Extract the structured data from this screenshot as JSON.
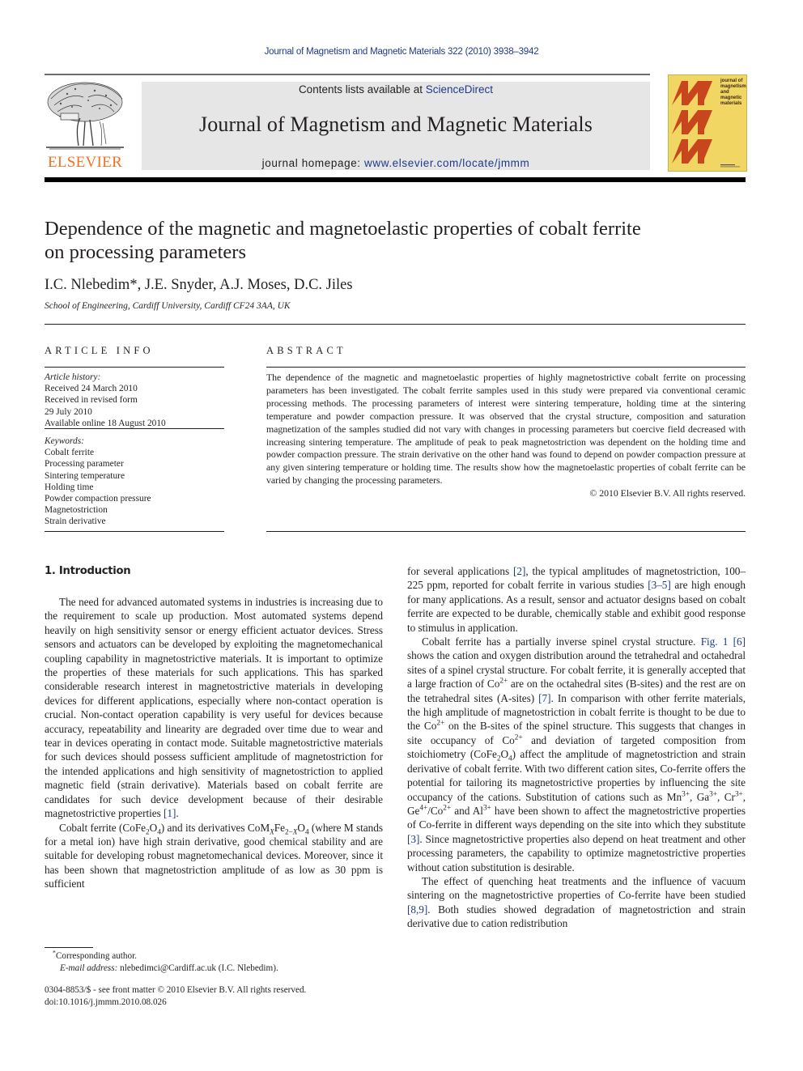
{
  "running_head": "Journal of Magnetism and Magnetic Materials 322 (2010) 3938–3942",
  "header": {
    "publisher_logo_text": "ELSEVIER",
    "contents_prefix": "Contents lists available at ",
    "contents_link": "ScienceDirect",
    "journal_title": "Journal of Magnetism and Magnetic Materials",
    "homepage_prefix": "journal homepage: ",
    "homepage_link": "www.elsevier.com/locate/jmmm",
    "cover_text": "journal of magnetism and magnetic materials",
    "cover_logo": "MMM",
    "colors": {
      "elsevier_orange": "#f37021",
      "cover_yellow": "#f2d663",
      "cover_red": "#c8461e",
      "link_blue": "#1f3a8a",
      "banner_gray": "#e6e6e6"
    }
  },
  "article": {
    "title": "Dependence of the magnetic and magnetoelastic properties of cobalt ferrite on processing parameters",
    "authors": "I.C. Nlebedim*, J.E. Snyder, A.J. Moses, D.C. Jiles",
    "affiliation": "School of Engineering, Cardiff University, Cardiff CF24 3AA, UK"
  },
  "article_info": {
    "label": "ARTICLE INFO",
    "history_label": "Article history:",
    "history": [
      "Received 24 March 2010",
      "Received in revised form",
      "29 July 2010",
      "Available online 18 August 2010"
    ],
    "keywords_label": "Keywords:",
    "keywords": [
      "Cobalt ferrite",
      "Processing parameter",
      "Sintering temperature",
      "Holding time",
      "Powder compaction pressure",
      "Magnetostriction",
      "Strain derivative"
    ]
  },
  "abstract": {
    "label": "ABSTRACT",
    "text": "The dependence of the magnetic and magnetoelastic properties of highly magnetostrictive cobalt ferrite on processing parameters has been investigated. The cobalt ferrite samples used in this study were prepared via conventional ceramic processing methods. The processing parameters of interest were sintering temperature, holding time at the sintering temperature and powder compaction pressure. It was observed that the crystal structure, composition and saturation magnetization of the samples studied did not vary with changes in processing parameters but coercive field decreased with increasing sintering temperature. The amplitude of peak to peak magnetostriction was dependent on the holding time and powder compaction pressure. The strain derivative on the other hand was found to depend on powder compaction pressure at any given sintering temperature or holding time. The results show how the magnetoelastic properties of cobalt ferrite can be varied by changing the processing parameters.",
    "copyright": "© 2010 Elsevier B.V. All rights reserved."
  },
  "intro": {
    "heading": "1.  Introduction",
    "p1": "The need for advanced automated systems in industries is increasing due to the requirement to scale up production. Most automated systems depend heavily on high sensitivity sensor or energy efficient actuator devices. Stress sensors and actuators can be developed by exploiting the magnetomechanical coupling capability in magnetostrictive materials. It is important to optimize the properties of these materials for such applications. This has sparked considerable research interest in magnetostrictive materials in developing devices for different applications, especially where non-contact operation is crucial. Non-contact operation capability is very useful for devices because accuracy, repeatability and linearity are degraded over time due to wear and tear in devices operating in contact mode. Suitable magnetostrictive materials for such devices should possess sufficient amplitude of magnetostriction for the intended applications and high sensitivity of magnetostriction to applied magnetic field (strain derivative). Materials based on cobalt ferrite are candidates for such device development because of their desirable magnetostrictive properties ",
    "ref1": "[1]",
    "p2_a": "Cobalt ferrite (CoFe",
    "p2_b": ") and its derivatives CoM",
    "p2_c": " (where M stands for a metal ion) have high strain derivative, good chemical stability and are suitable for developing robust magnetomechanical devices. Moreover, since it has been shown that magnetostriction amplitude of as low as 30 ppm is sufficient",
    "r_p1_a": "for several applications ",
    "ref2": "[2]",
    "r_p1_b": ", the typical amplitudes of magnetostriction, 100–225 ppm, reported for cobalt ferrite in various studies ",
    "ref3_5": "[3–5]",
    "r_p1_c": " are high enough for many applications. As a result, sensor and actuator designs based on cobalt ferrite are expected to be durable, chemically stable and exhibit good response to stimulus in application.",
    "r_p2_a": "Cobalt ferrite has a partially inverse spinel crystal structure. ",
    "fig1": "Fig. 1",
    "ref6": "[6]",
    "r_p2_b": " shows the cation and oxygen distribution around the tetrahedral and octahedral sites of a spinel crystal structure. For cobalt ferrite, it is generally accepted that a large fraction of Co",
    "r_p2_c": " are on the octahedral sites (B-sites) and the rest are on the tetrahedral sites (A-sites) ",
    "ref7": "[7]",
    "r_p2_d": ". In comparison with other ferrite materials, the high amplitude of magnetostriction in cobalt ferrite is thought to be due to the Co",
    "r_p2_e": " on the B-sites of the spinel structure. This suggests that changes in site occupancy of Co",
    "r_p2_f": " and deviation of targeted composition from stoichiometry (CoFe",
    "r_p2_g": ") affect the amplitude of magnetostriction and strain derivative of cobalt ferrite. With two different cation sites, Co-ferrite offers the potential for tailoring its magnetostrictive properties by influencing the site occupancy of the cations. Substitution of cations such as Mn",
    "r_p2_h": " have been shown to affect the magnetostrictive properties of Co-ferrite in different ways depending on the site into which they substitute ",
    "ref3": "[3]",
    "r_p2_i": ". Since magnetostrictive properties also depend on heat treatment and other processing parameters, the capability to optimize magnetostrictive properties without cation substitution is desirable.",
    "r_p3_a": "The effect of quenching heat treatments and the influence of vacuum sintering on the magnetostrictive properties of Co-ferrite have been studied ",
    "ref8_9": "[8,9]",
    "r_p3_b": ". Both studies showed degradation of magnetostriction and strain derivative due to cation redistribution"
  },
  "footnotes": {
    "corresponding": "Corresponding author.",
    "email_label": "E-mail address:",
    "email": " nlebedimci@Cardiff.ac.uk (I.C. Nlebedim).",
    "issn": "0304-8853/$ - see front matter © 2010 Elsevier B.V. All rights reserved.",
    "doi": "doi:10.1016/j.jmmm.2010.08.026"
  }
}
